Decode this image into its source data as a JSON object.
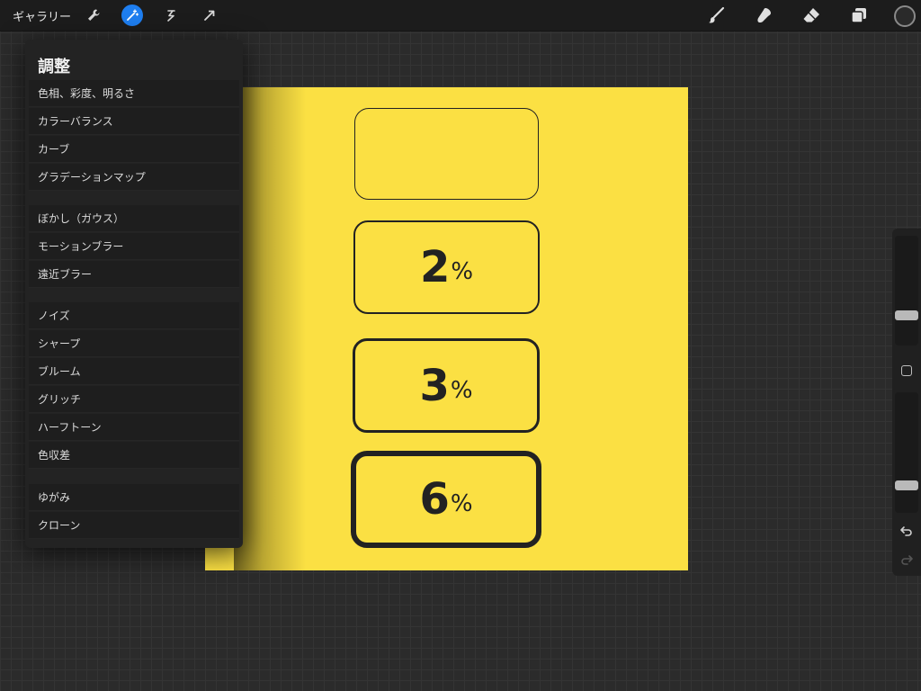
{
  "toolbar": {
    "gallery_label": "ギャラリー",
    "left_tools": [
      "wrench-icon",
      "magic-wand-icon",
      "selection-icon",
      "transform-arrow-icon"
    ],
    "active_tool": "magic-wand-icon",
    "right_tools": [
      "brush-icon",
      "smudge-icon",
      "eraser-icon",
      "layers-icon"
    ],
    "current_color": "#2a2a2a"
  },
  "adjustments": {
    "title": "調整",
    "groups": [
      [
        "色相、彩度、明るさ",
        "カラーバランス",
        "カーブ",
        "グラデーションマップ"
      ],
      [
        "ぼかし（ガウス）",
        "モーションブラー",
        "遠近ブラー"
      ],
      [
        "ノイズ",
        "シャープ",
        "ブルーム",
        "グリッチ",
        "ハーフトーン",
        "色収差"
      ],
      [
        "ゆがみ",
        "クローン"
      ]
    ]
  },
  "canvas": {
    "background": "#fbe043",
    "boxes": [
      {
        "number": "",
        "unit": ""
      },
      {
        "number": "2",
        "unit": "%"
      },
      {
        "number": "3",
        "unit": "%"
      },
      {
        "number": "6",
        "unit": "%"
      }
    ]
  },
  "sidebar": {
    "brush_size_level": 0.25,
    "opacity_level": 0.2
  }
}
